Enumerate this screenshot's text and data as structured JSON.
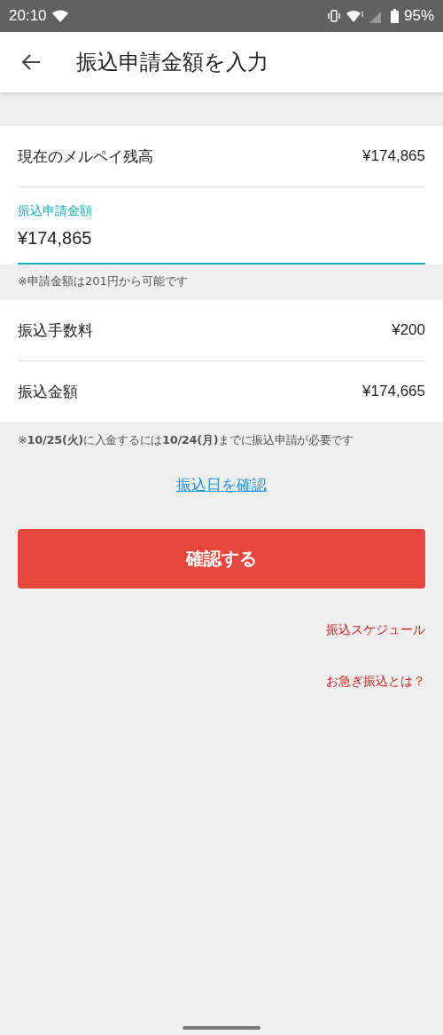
{
  "status_bar": {
    "time": "20:10",
    "battery": "95%"
  },
  "header": {
    "title": "振込申請金額を入力"
  },
  "balance": {
    "label": "現在のメルペイ残高",
    "value": "¥174,865"
  },
  "amount_field": {
    "label": "振込申請金額",
    "value": "¥174,865",
    "focused": true
  },
  "amount_note": "※申請金額は201円から可能です",
  "fees": [
    {
      "label": "振込手数料",
      "value": "¥200"
    },
    {
      "label": "振込金額",
      "value": "¥174,665"
    }
  ],
  "deadline_note": "※**10/25(火)**に入金するには**10/24(月)**までに振込申請が必要です",
  "check_date_link": "振込日を確認",
  "confirm_button": "確認する",
  "links": [
    "振込スケジュール",
    "お急ぎ振込とは？"
  ]
}
